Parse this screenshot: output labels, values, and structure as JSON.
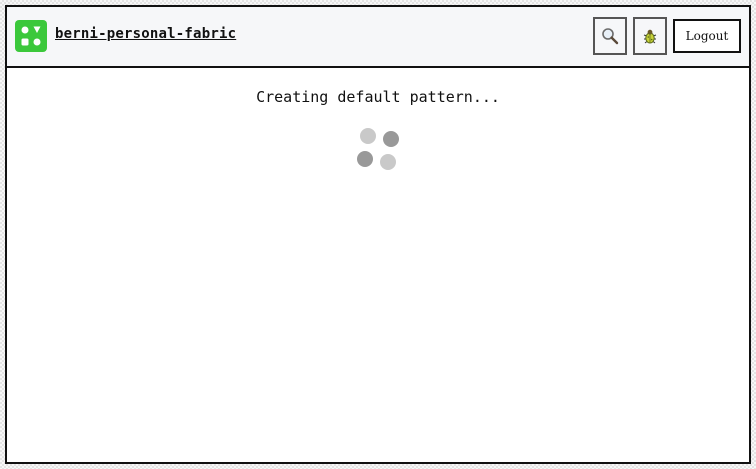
{
  "header": {
    "app_name": "berni-personal-fabric",
    "logo_icon": "fabric-logo-icon",
    "search_icon": "magnifier-icon",
    "debug_icon": "bug-icon",
    "logout_label": "Logout"
  },
  "main": {
    "status_text": "Creating default pattern...",
    "spinner": "loading-spinner"
  },
  "colors": {
    "logo_green": "#3bc83b",
    "header_bg": "#f6f7f9",
    "border": "#111111",
    "spinner_light": "#c9c9c9",
    "spinner_dark": "#999999"
  }
}
